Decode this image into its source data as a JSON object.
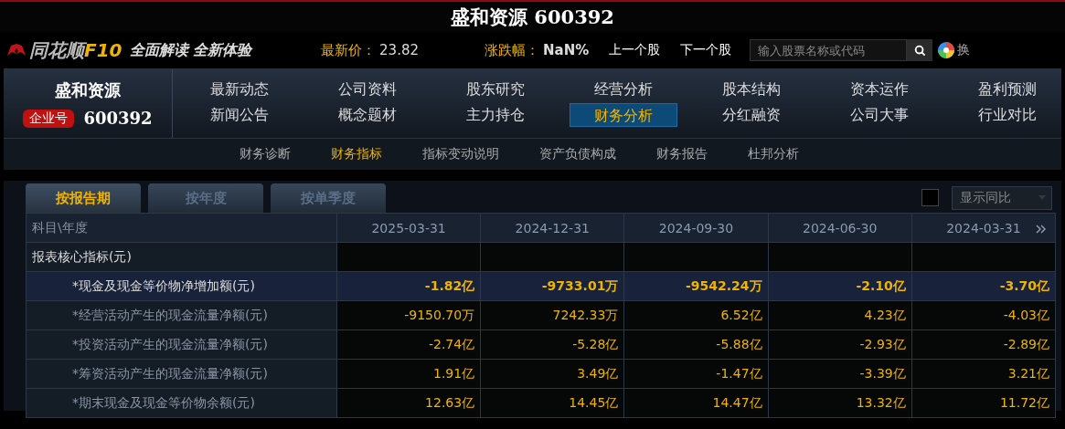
{
  "window": {
    "title": "盛和资源 600392"
  },
  "topbar": {
    "brand": "同花顺",
    "brand_suffix": "F10",
    "slogan": "全面解读 全新体验",
    "price_label": "最新价：",
    "price": "23.82",
    "change_label": "涨跌幅：",
    "change": "NaN%",
    "prev": "上一个股",
    "next": "下一个股",
    "search": {
      "placeholder": "输入股票名称或代码"
    },
    "skin": "换"
  },
  "company": {
    "name": "盛和资源",
    "badge": "企业号",
    "code": "600392"
  },
  "nav": [
    {
      "label": "最新动态",
      "selected": false
    },
    {
      "label": "公司资料",
      "selected": false
    },
    {
      "label": "股东研究",
      "selected": false
    },
    {
      "label": "经营分析",
      "selected": false
    },
    {
      "label": "股本结构",
      "selected": false
    },
    {
      "label": "资本运作",
      "selected": false
    },
    {
      "label": "盈利预测",
      "selected": false
    },
    {
      "label": "新闻公告",
      "selected": false
    },
    {
      "label": "概念题材",
      "selected": false
    },
    {
      "label": "主力持仓",
      "selected": false
    },
    {
      "label": "财务分析",
      "selected": true
    },
    {
      "label": "分红融资",
      "selected": false
    },
    {
      "label": "公司大事",
      "selected": false
    },
    {
      "label": "行业对比",
      "selected": false
    }
  ],
  "subnav": [
    {
      "label": "财务诊断",
      "selected": false
    },
    {
      "label": "财务指标",
      "selected": true
    },
    {
      "label": "指标变动说明",
      "selected": false
    },
    {
      "label": "资产负债构成",
      "selected": false
    },
    {
      "label": "财务报告",
      "selected": false
    },
    {
      "label": "杜邦分析",
      "selected": false
    }
  ],
  "tabs": [
    {
      "label": "按报告期",
      "selected": true
    },
    {
      "label": "按年度",
      "selected": false
    },
    {
      "label": "按单季度",
      "selected": false
    }
  ],
  "compare": {
    "checked": false,
    "label": "显示同比"
  },
  "table": {
    "columns": [
      "科目\\年度",
      "2025-03-31",
      "2024-12-31",
      "2024-09-30",
      "2024-06-30",
      "2024-03-31"
    ],
    "rows": [
      {
        "kind": "section",
        "label": "报表核心指标(元)",
        "selected": false,
        "values": []
      },
      {
        "kind": "item",
        "label": "*现金及现金等价物净增加额(元)",
        "selected": true,
        "values": [
          "-1.82亿",
          "-9733.01万",
          "-9542.24万",
          "-2.10亿",
          "-3.70亿"
        ]
      },
      {
        "kind": "item",
        "label": "*经营活动产生的现金流量净额(元)",
        "selected": false,
        "values": [
          "-9150.70万",
          "7242.33万",
          "6.52亿",
          "4.23亿",
          "-4.03亿"
        ]
      },
      {
        "kind": "item",
        "label": "*投资活动产生的现金流量净额(元)",
        "selected": false,
        "values": [
          "-2.74亿",
          "-5.28亿",
          "-5.88亿",
          "-2.93亿",
          "-2.89亿"
        ]
      },
      {
        "kind": "item",
        "label": "*筹资活动产生的现金流量净额(元)",
        "selected": false,
        "values": [
          "1.91亿",
          "3.49亿",
          "-1.47亿",
          "-3.39亿",
          "3.21亿"
        ]
      },
      {
        "kind": "item",
        "label": "*期末现金及现金等价物余额(元)",
        "selected": false,
        "values": [
          "12.63亿",
          "14.45亿",
          "14.47亿",
          "13.32亿",
          "11.72亿"
        ]
      }
    ]
  }
}
